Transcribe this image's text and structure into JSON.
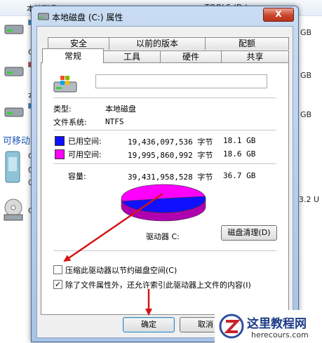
{
  "background": {
    "drive_label_1": "本地磁盘 (C:)",
    "drive_label_2": "TOOLS (D:)",
    "gb_1": "GB",
    "gb_2": "GB",
    "gb_3": "GB",
    "letter_c1": "C",
    "letter_c2": "本",
    "letter_c3": "C",
    "letter_c4": "C",
    "zero_1": "0",
    "zero_2": "0",
    "removable_heading": "可移动",
    "partial_size": "3.2 U"
  },
  "dialog": {
    "title": "本地磁盘 (C:) 属性",
    "close_label": "X",
    "tabs_back": [
      "安全",
      "以前的版本",
      "配额"
    ],
    "tabs_front": [
      "常规",
      "工具",
      "硬件",
      "共享"
    ],
    "name_value": "",
    "type_label": "类型:",
    "type_value": "本地磁盘",
    "fs_label": "文件系统:",
    "fs_value": "NTFS",
    "used_label": "已用空间:",
    "used_bytes": "19,436,097,536 字节",
    "used_gb": "18.1 GB",
    "free_label": "可用空间:",
    "free_bytes": "19,995,860,992 字节",
    "free_gb": "18.6 GB",
    "capacity_label": "容量:",
    "capacity_bytes": "39,431,958,528 字节",
    "capacity_gb": "36.7 GB",
    "drive_caption": "驱动器 C:",
    "cleanup_button": "磁盘清理(D)",
    "compress_label": "压缩此驱动器以节约磁盘空间(C)",
    "compress_checked": false,
    "index_label": "除了文件属性外，还允许索引此驱动器上文件的内容(I)",
    "index_checked": true,
    "ok_button": "确定",
    "cancel_button": "取消"
  },
  "chart_data": {
    "type": "pie",
    "categories": [
      "已用空间",
      "可用空间"
    ],
    "values": [
      18.1,
      18.6
    ],
    "colors": [
      "#1010ff",
      "#ff00ff"
    ]
  },
  "watermark": {
    "site_name": "这里教程网",
    "site_url": "herecours.com"
  },
  "colors": {
    "used": "#1010ff",
    "free": "#ff00ff",
    "arrow": "#d51515"
  }
}
